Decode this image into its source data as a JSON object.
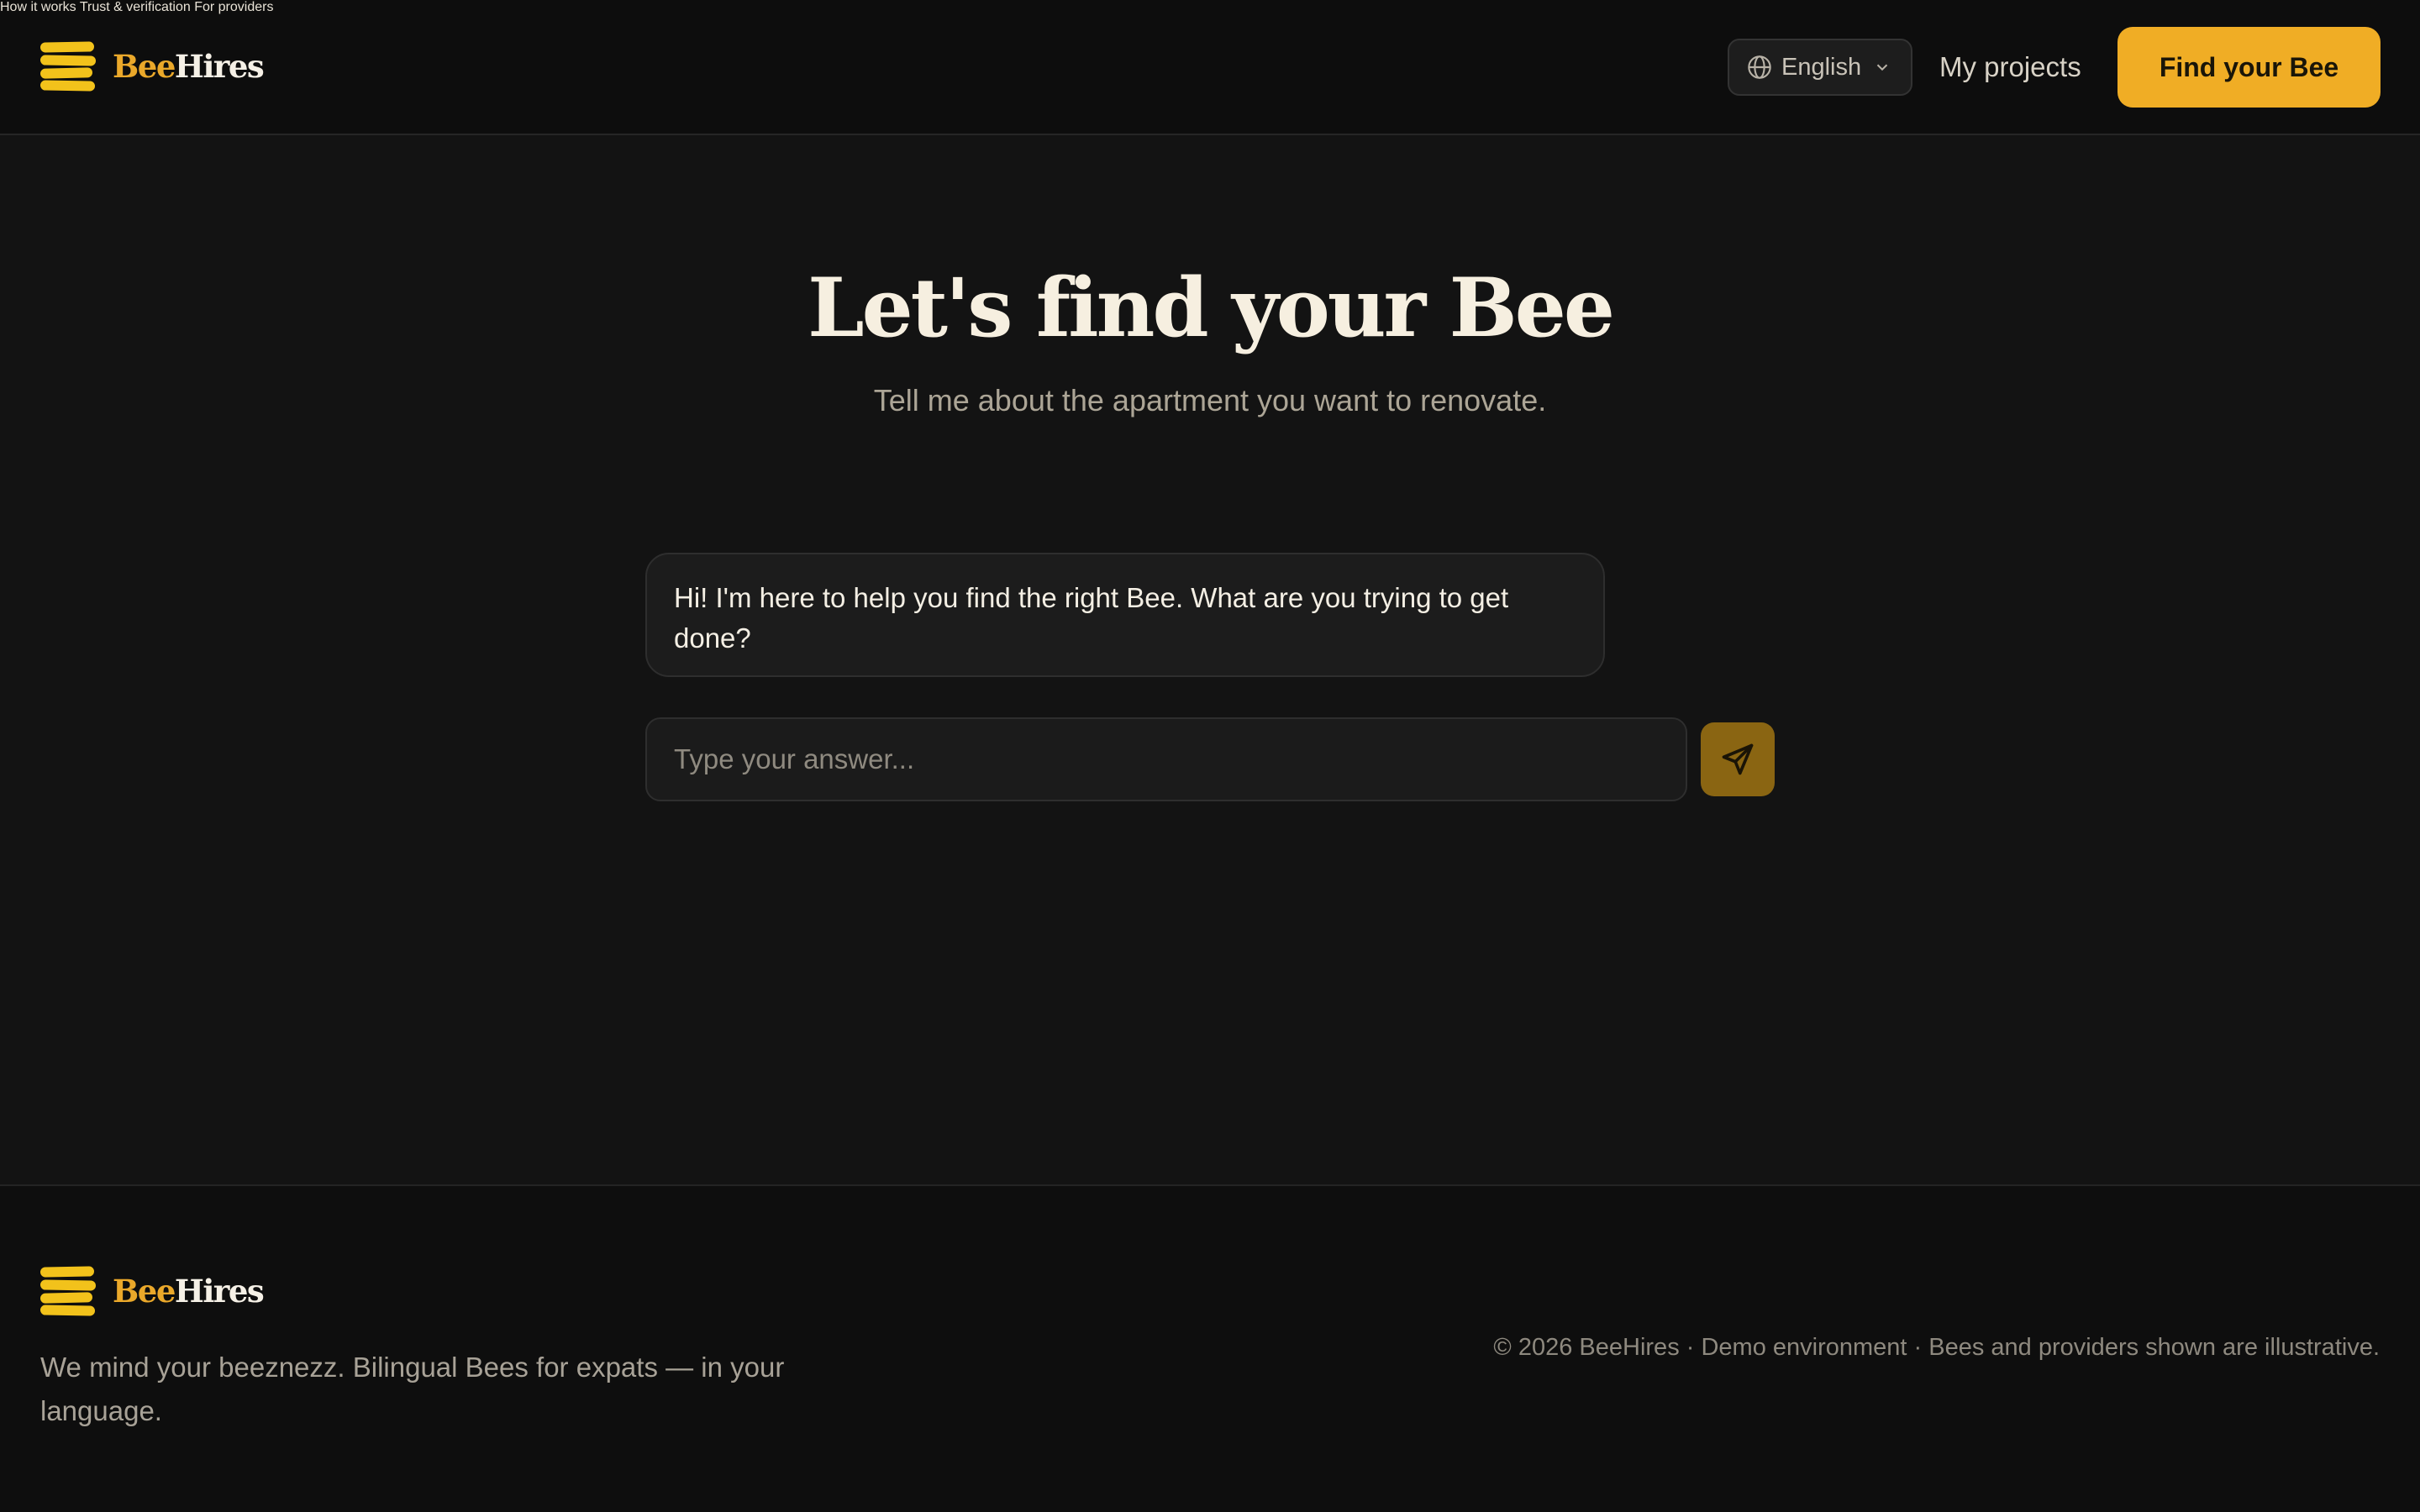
{
  "brand": {
    "part1": "Bee",
    "part2": "Hires"
  },
  "nav": {
    "items": [
      {
        "label": "How it works"
      },
      {
        "label": "Trust & verification"
      },
      {
        "label": "For providers"
      }
    ],
    "language": "English",
    "my_projects": "My projects",
    "cta": "Find your Bee"
  },
  "hero": {
    "title": "Let's find your Bee",
    "subtitle": "Tell me about the apartment you want to renovate."
  },
  "chat": {
    "assistant_message": "Hi! I'm here to help you find the right Bee. What are you trying to get done?",
    "input_placeholder": "Type your answer...",
    "input_value": ""
  },
  "footer": {
    "tagline": "We mind your beeznezz. Bilingual Bees for expats — in your language.",
    "copyright": "© 2026 BeeHires · Demo environment · Bees and providers shown are illustrative."
  },
  "colors": {
    "accent": "#f0ad25",
    "logo_yellow": "#f2c21b",
    "background": "#131313",
    "send_button": "#8a6512"
  },
  "icons": {
    "logo": "bee-stripes-icon",
    "language": "globe-icon",
    "dropdown": "chevron-down-icon",
    "send": "send-icon"
  }
}
